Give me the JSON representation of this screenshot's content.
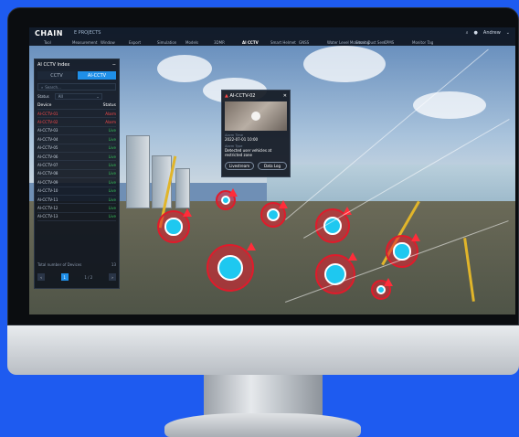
{
  "app": {
    "brand": "CHAIN",
    "project": "E PROJECTS",
    "user": "Andrew"
  },
  "nav": [
    "Tool",
    "Measurement",
    "Window",
    "Export",
    "Simulation",
    "Models",
    "3DMR",
    "AI CCTV",
    "Smart Helmet",
    "GNSS",
    "Water Level Monitoring",
    "Smart Dust Sens",
    "CPMS",
    "Monitor Tag"
  ],
  "nav_active_index": 7,
  "panel": {
    "title": "AI CCTV Index",
    "close": "−",
    "tabs": [
      "CCTV",
      "AI-CCTV"
    ],
    "active_tab": 1,
    "search_placeholder": "Search...",
    "status_label": "Status",
    "status_value": "All",
    "col_device": "Device",
    "col_status": "Status",
    "rows": [
      {
        "device": "AI-CCTV-01",
        "status": "Alarm",
        "alarm": true
      },
      {
        "device": "AI-CCTV-02",
        "status": "Alarm",
        "alarm": true
      },
      {
        "device": "AI-CCTV-03",
        "status": "Live",
        "alarm": false
      },
      {
        "device": "AI-CCTV-04",
        "status": "Live",
        "alarm": false
      },
      {
        "device": "AI-CCTV-05",
        "status": "Live",
        "alarm": false
      },
      {
        "device": "AI-CCTV-06",
        "status": "Live",
        "alarm": false
      },
      {
        "device": "AI-CCTV-07",
        "status": "Live",
        "alarm": false
      },
      {
        "device": "AI-CCTV-08",
        "status": "Live",
        "alarm": false
      },
      {
        "device": "AI-CCTV-09",
        "status": "Live",
        "alarm": false
      },
      {
        "device": "AI-CCTV-10",
        "status": "Live",
        "alarm": false
      },
      {
        "device": "AI-CCTV-11",
        "status": "Live",
        "alarm": false
      },
      {
        "device": "AI-CCTV-12",
        "status": "Live",
        "alarm": false
      },
      {
        "device": "AI-CCTV-13",
        "status": "Live",
        "alarm": false
      }
    ],
    "total_label": "Total number of Devices",
    "total_value": "13",
    "pager": {
      "prev": "‹",
      "next": "›",
      "current": "1",
      "pages": "1 / 2"
    }
  },
  "popup": {
    "title": "AI-CCTV-02",
    "close": "✕",
    "date_label": "Alarm Time",
    "date_value": "2022-07-01 10:00",
    "type_label": "Alarm Type",
    "type_value": "Detected user vehicles at restricted zone",
    "btn_livestream": "Livestream",
    "btn_datalog": "Data Log"
  },
  "colors": {
    "accent": "#1f8fe8",
    "alarm": "#ff4a4a",
    "live": "#36c35a",
    "background": "#1e5bf0"
  },
  "icons": {
    "search": "search-icon",
    "camera": "camera-icon",
    "warning": "warning-icon",
    "play": "play-icon"
  }
}
